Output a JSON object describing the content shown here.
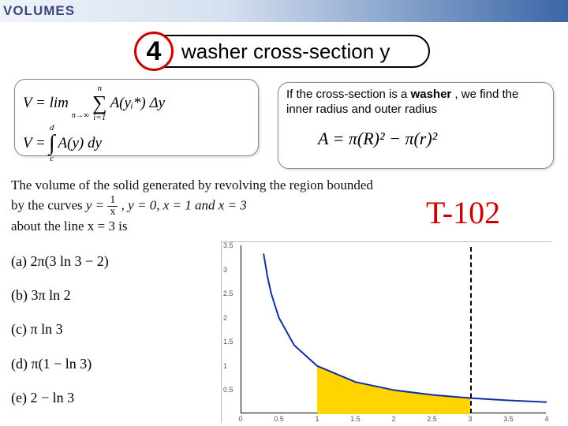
{
  "header": {
    "title": "VOLUMES"
  },
  "step": {
    "number": "4",
    "label": "washer cross-section   y"
  },
  "volume_formulas": {
    "lim_lower": "n→∞",
    "sigma_top": "n",
    "sigma_bottom": "i=1",
    "line1_left": "V = lim",
    "line1_right": "A(yᵢ*) Δy",
    "int_top": "d",
    "int_bottom": "c",
    "line2_left": "V =",
    "line2_right": "A(y) dy"
  },
  "washer": {
    "desc_prefix": "If the cross-section is a ",
    "desc_bold": "washer",
    "desc_suffix": " , we find the inner  radius and outer radius",
    "area": "A = π(R)² − π(r)²"
  },
  "problem": {
    "lead": "The volume of the solid generated by revolving the region bounded by the curves ",
    "eq1a": "y = ",
    "eq1_num": "1",
    "eq1_den": "x",
    "eq_rest": ", y = 0, x = 1 and x = 3",
    "about": "about the line x = 3 is"
  },
  "choices": {
    "a": "(a)   2π(3 ln 3 − 2)",
    "b": "(b)   3π ln 2",
    "c": "(c)   π ln 3",
    "d": "(d)   π(1 − ln 3)",
    "e": "(e)   2 − ln 3"
  },
  "tcode": "T-102",
  "chart_data": {
    "type": "line",
    "title": "",
    "xlabel": "",
    "ylabel": "",
    "xlim": [
      0,
      4
    ],
    "ylim": [
      0,
      3.5
    ],
    "xticks": [
      0,
      0.5,
      1,
      1.5,
      2,
      2.5,
      3,
      3.5,
      4
    ],
    "yticks": [
      0.5,
      1,
      1.5,
      2,
      2.5,
      3,
      3.5
    ],
    "series": [
      {
        "name": "y=1/x",
        "x": [
          0.3,
          0.35,
          0.4,
          0.5,
          0.7,
          1,
          1.5,
          2,
          2.5,
          3,
          3.5,
          4
        ],
        "y": [
          3.33,
          2.86,
          2.5,
          2.0,
          1.43,
          1.0,
          0.667,
          0.5,
          0.4,
          0.333,
          0.286,
          0.25
        ]
      }
    ],
    "shaded_region": {
      "x_from": 1,
      "x_to": 3,
      "fill": "#ffd400"
    },
    "vlines": [
      {
        "x": 3,
        "style": "dashed"
      }
    ]
  }
}
